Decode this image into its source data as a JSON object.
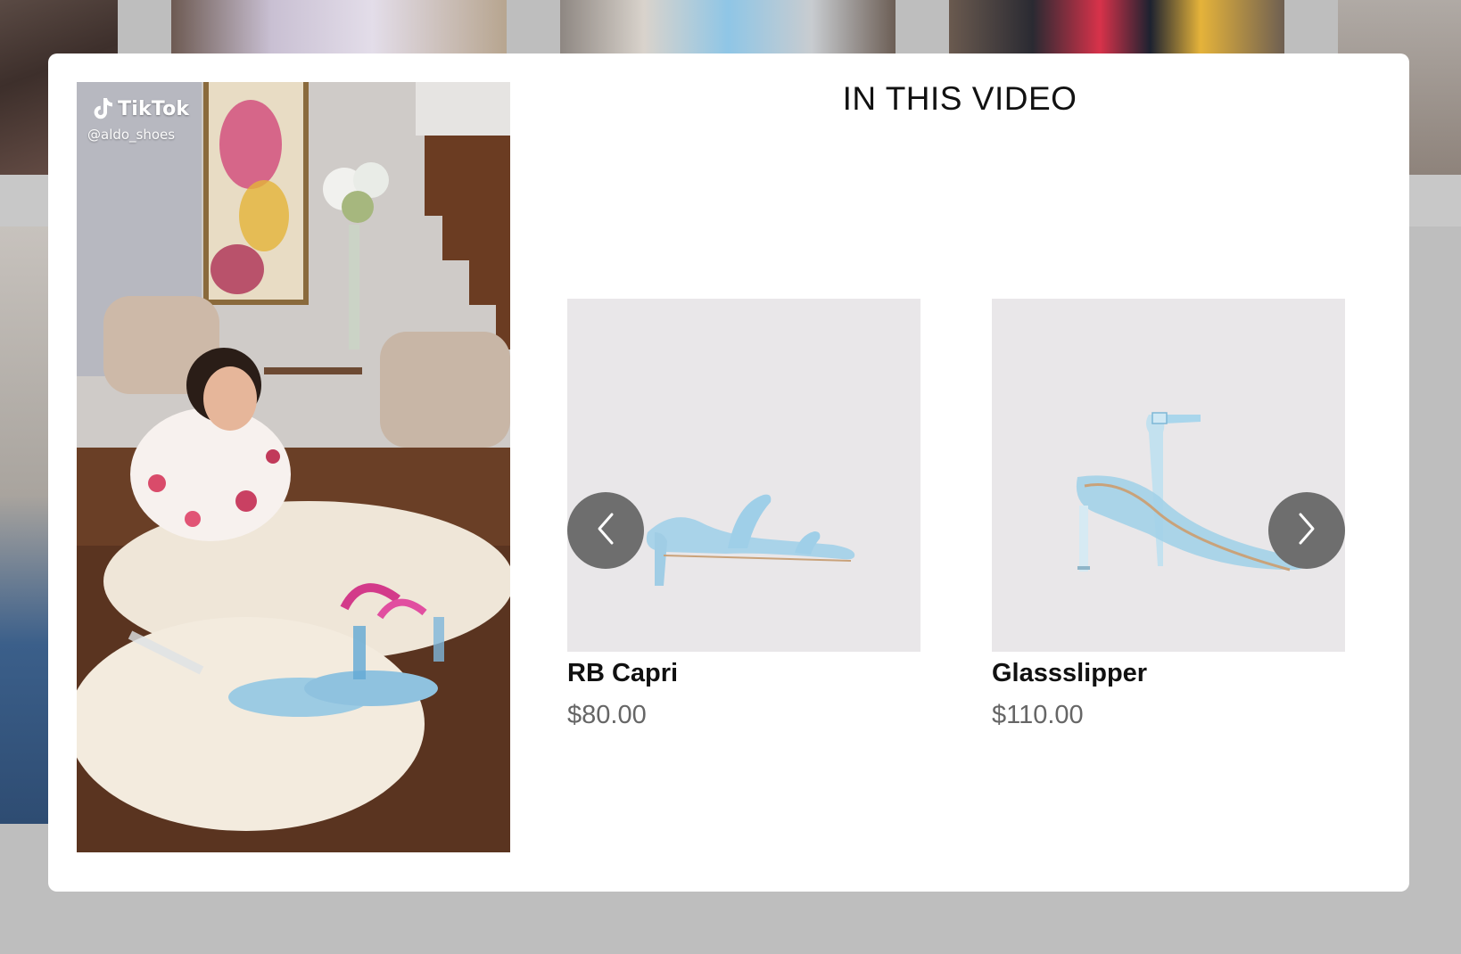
{
  "modal": {
    "title": "IN THIS VIDEO"
  },
  "video": {
    "platform": "TikTok",
    "handle": "@aldo_shoes"
  },
  "products": [
    {
      "name": "RB Capri",
      "price": "$80.00"
    },
    {
      "name": "Glassslipper",
      "price": "$110.00"
    }
  ],
  "carousel": {
    "prev_icon": "chevron-left-icon",
    "next_icon": "chevron-right-icon"
  },
  "colors": {
    "overlay": "#bebebe",
    "modal_bg": "#ffffff",
    "product_bg": "#e9e7e9",
    "arrow_bg": "#6e6e6e",
    "price_text": "#666666"
  }
}
